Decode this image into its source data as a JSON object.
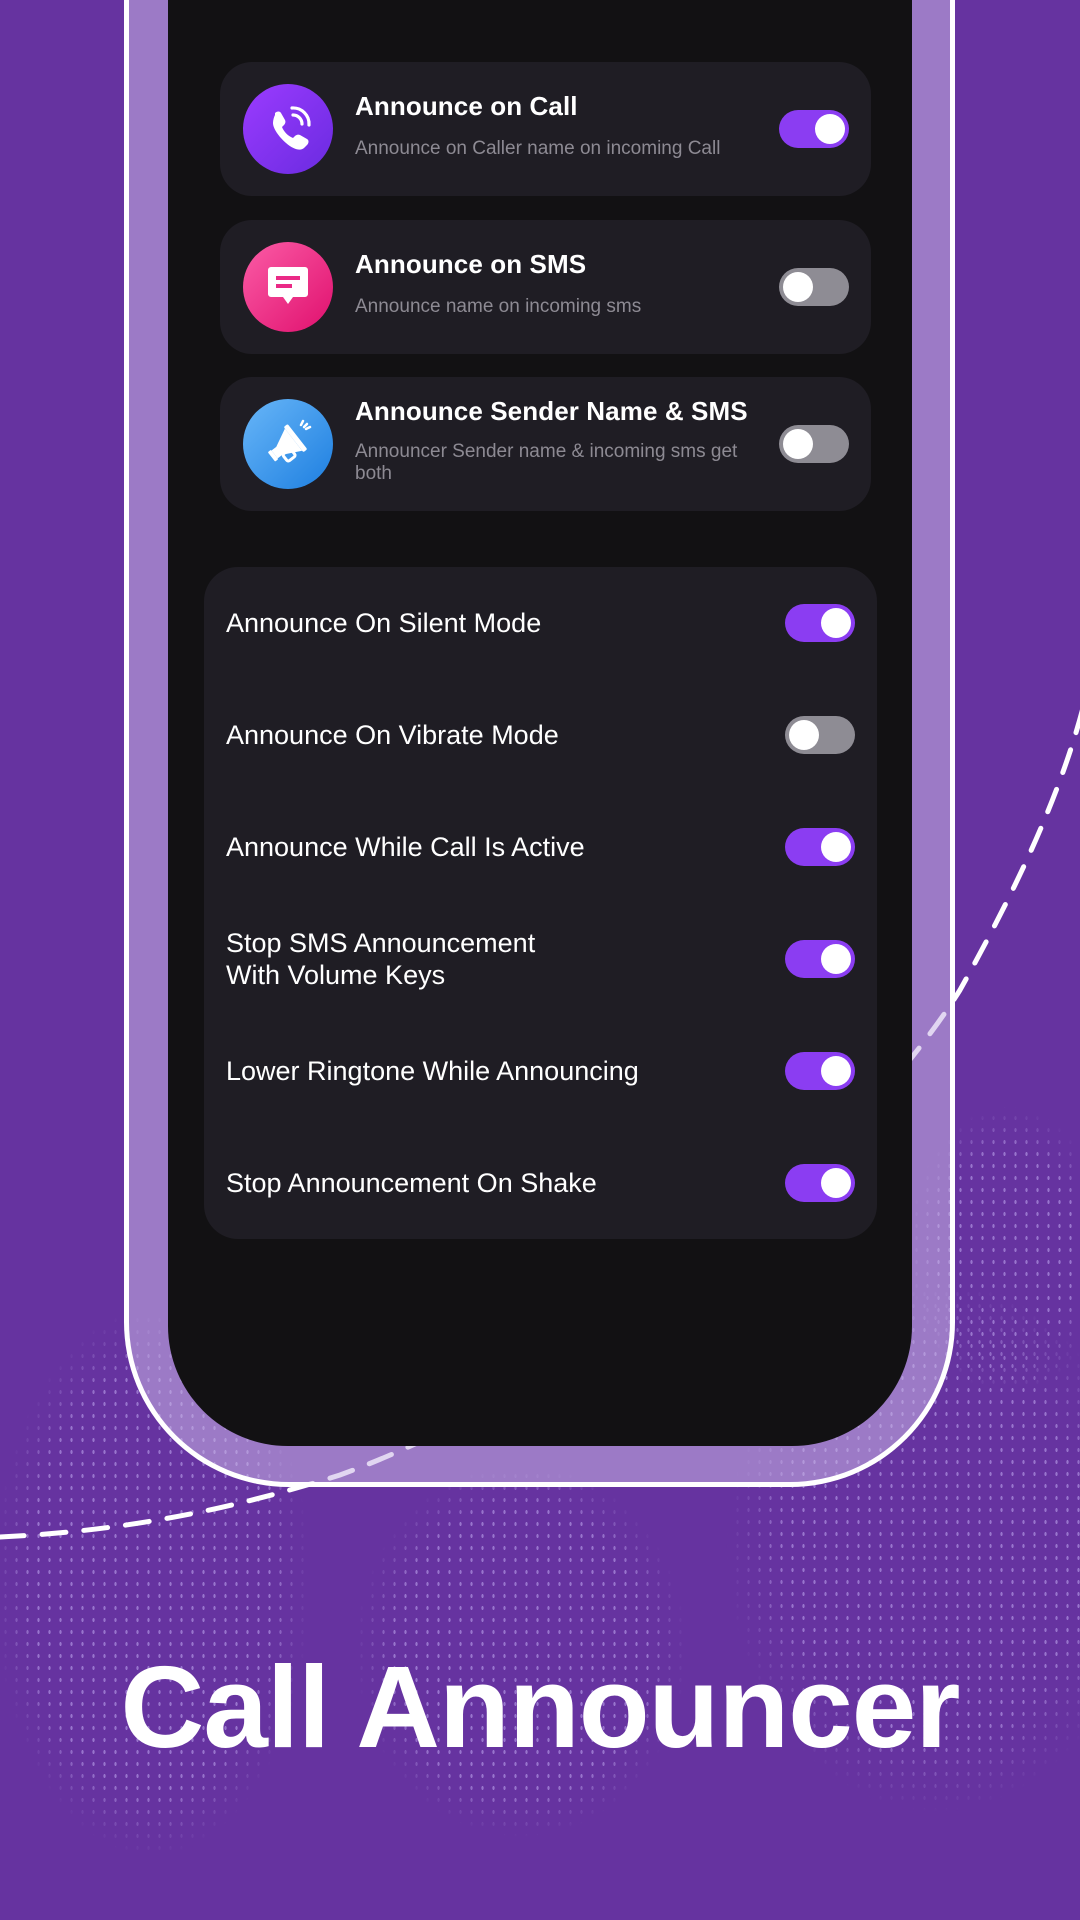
{
  "colors": {
    "background": "#6633A0",
    "screen": "#121113",
    "card": "#1F1D24",
    "toggle_on": "#8B3DF2",
    "toggle_off": "#8E8C94",
    "subtitle": "#8D8A93"
  },
  "cards": [
    {
      "icon": "phone-call-icon",
      "title": "Announce on Call",
      "subtitle": "Announce on Caller name on incoming Call",
      "enabled": true
    },
    {
      "icon": "message-bubble-icon",
      "title": "Announce on SMS",
      "subtitle": "Announce name on incoming sms",
      "enabled": false
    },
    {
      "icon": "megaphone-icon",
      "title": "Announce Sender Name & SMS",
      "subtitle": "Announcer Sender name & incoming sms get both",
      "enabled": false
    }
  ],
  "settings": [
    {
      "label": "Announce On Silent Mode",
      "enabled": true
    },
    {
      "label": "Announce On Vibrate Mode",
      "enabled": false
    },
    {
      "label": "Announce While Call Is Active",
      "enabled": true
    },
    {
      "label": "Stop SMS Announcement With Volume Keys",
      "enabled": true
    },
    {
      "label": "Lower Ringtone While Announcing",
      "enabled": true
    },
    {
      "label": "Stop Announcement On Shake",
      "enabled": true
    }
  ],
  "headline": "Call Announcer"
}
